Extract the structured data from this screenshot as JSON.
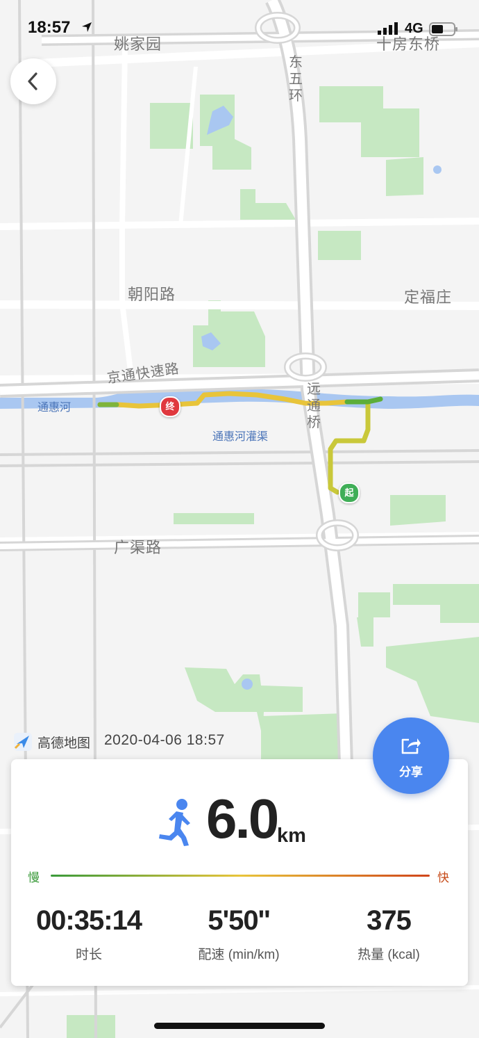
{
  "status_bar": {
    "time": "18:57",
    "network": "4G"
  },
  "map": {
    "labels": {
      "yaojiayuan": "姚家园",
      "shifangdongqiao": "十房东桥",
      "dongwuhuan": "东五环",
      "chaoyanglu": "朝阳路",
      "dingfuzhuang": "定福庄",
      "jingtong": "京通快速路",
      "yuantongqiao": "远通桥",
      "guangqulu": "广渠路"
    },
    "water_labels": {
      "tonghuihe": "通惠河",
      "guanqu": "通惠河灌渠"
    },
    "markers": {
      "end": "终",
      "start": "起"
    }
  },
  "attribution": {
    "provider": "高德地图",
    "timestamp": "2020-04-06 18:57"
  },
  "share_button": {
    "label": "分享"
  },
  "summary": {
    "distance": "6.0",
    "distance_unit": "km",
    "pace_scale": {
      "slow": "慢",
      "fast": "快"
    },
    "stats": [
      {
        "value": "00:35:14",
        "label": "时长"
      },
      {
        "value": "5'50''",
        "label": "配速 (min/km)"
      },
      {
        "value": "375",
        "label": "热量 (kcal)"
      }
    ]
  },
  "colors": {
    "accent": "#4a86ef",
    "route_yellow": "#e8c43a",
    "route_green": "#8abf3a",
    "end_marker": "#e0383e",
    "start_marker": "#3fae57"
  }
}
